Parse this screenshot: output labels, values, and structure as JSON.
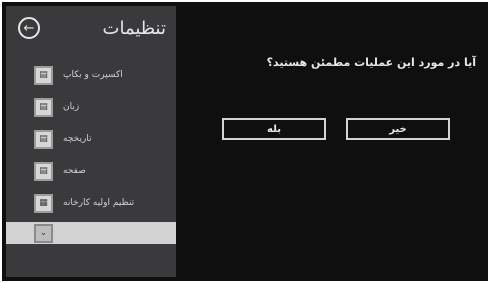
{
  "sidebar": {
    "title": "تنظیمات",
    "back_icon": "back-arrow-icon",
    "items": [
      {
        "label": "اکسپرت و بکاپ",
        "icon": "backup-icon"
      },
      {
        "label": "زبان",
        "icon": "language-icon"
      },
      {
        "label": "تاریخچه",
        "icon": "history-icon"
      },
      {
        "label": "صفحه",
        "icon": "display-icon"
      },
      {
        "label": "تنظیم اولیه کارخانه",
        "icon": "factory-reset-icon"
      },
      {
        "label": "",
        "icon": "download-icon"
      }
    ],
    "active_index": 5
  },
  "dialog": {
    "question": "آیا در مورد این عملیات مطمئن هستید؟",
    "yes_label": "بله",
    "no_label": "خیر"
  },
  "colors": {
    "background": "#0f0f10",
    "sidebar": "#3a3a3c",
    "active_item": "#d2d2d2",
    "text": "#e8e8e8"
  }
}
